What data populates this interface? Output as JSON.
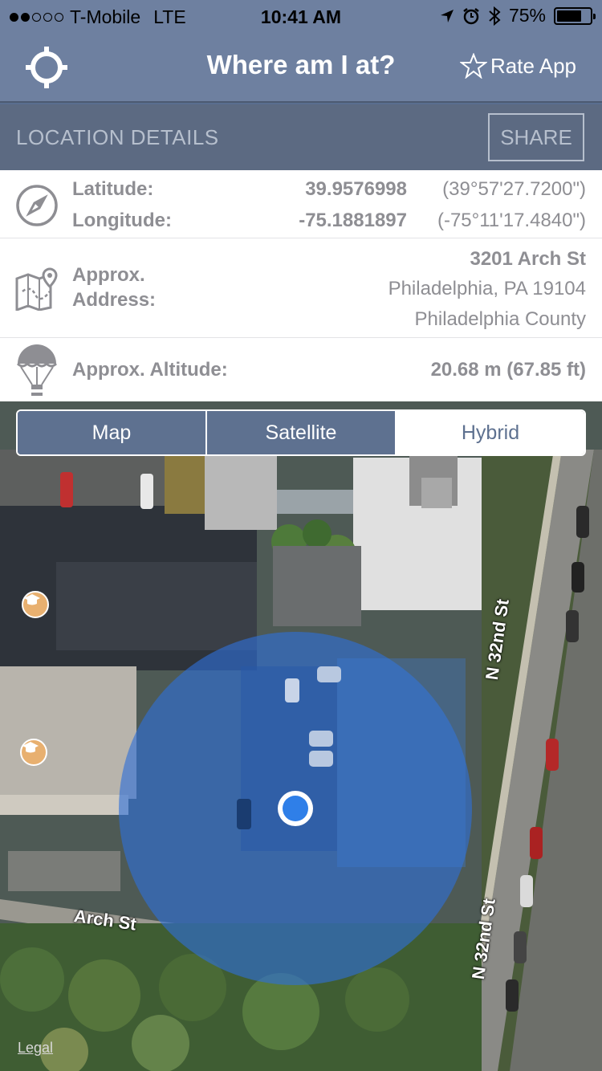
{
  "status_bar": {
    "carrier": "T-Mobile",
    "network": "LTE",
    "time": "10:41 AM",
    "battery": "75%",
    "battery_level": 0.75,
    "signal_bars_filled": 2,
    "signal_bars_total": 5
  },
  "nav": {
    "title": "Where am I at?",
    "rate_label": "Rate App"
  },
  "section": {
    "title": "LOCATION DETAILS",
    "share_label": "SHARE"
  },
  "coordinates": {
    "latitude_label": "Latitude:",
    "latitude_value": "39.9576998",
    "latitude_dms": "(39°57'27.7200\")",
    "longitude_label": "Longitude:",
    "longitude_value": "-75.1881897",
    "longitude_dms": "(-75°11'17.4840\")"
  },
  "address": {
    "label_line1": "Approx.",
    "label_line2": "Address:",
    "street": "3201 Arch St",
    "city": "Philadelphia, PA 19104",
    "county": "Philadelphia County"
  },
  "altitude": {
    "label": "Approx. Altitude:",
    "value": "20.68 m (67.85 ft)"
  },
  "map_type": {
    "options": [
      "Map",
      "Satellite",
      "Hybrid"
    ],
    "selected": "Hybrid"
  },
  "map": {
    "streets": [
      "N 32nd St",
      "N 32nd St",
      "Arch St"
    ],
    "legal_label": "Legal"
  },
  "icons": [
    "location-crosshair-icon",
    "star-icon",
    "compass-icon",
    "map-pin-icon",
    "balloon-icon",
    "graduation-cap-icon"
  ],
  "colors": {
    "nav_background": "#6e80a0",
    "section_background": "#5c6a82",
    "location_dot": "#2f7fe8",
    "accuracy_circle": "#2f6fd8"
  }
}
